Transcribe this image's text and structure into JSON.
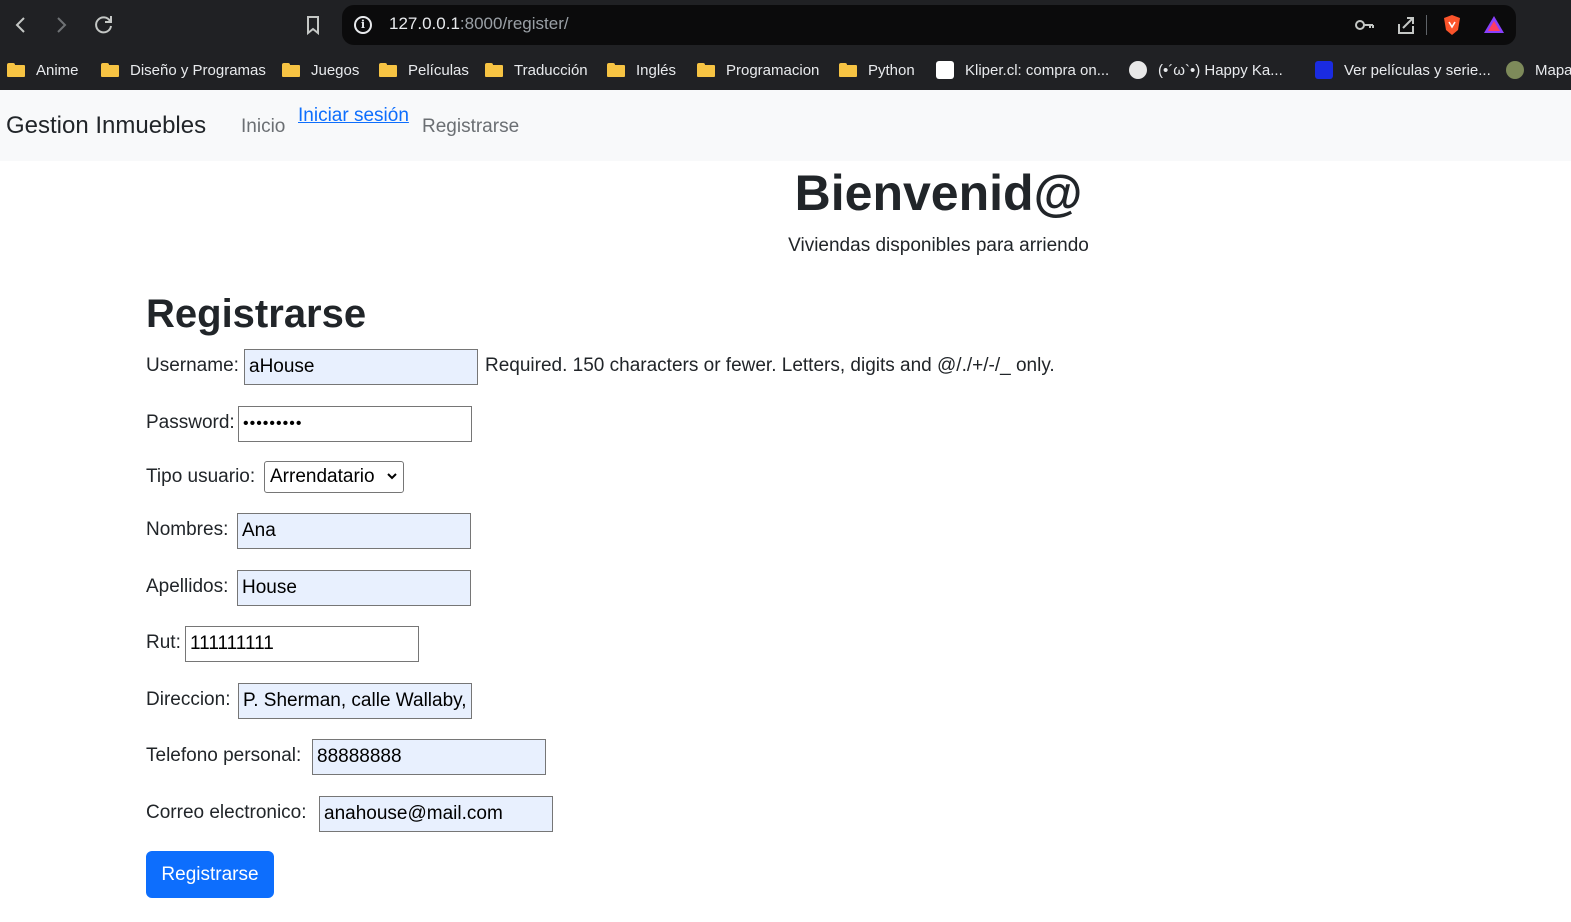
{
  "browser": {
    "url_host": "127.0.0.1",
    "url_rest": ":8000/register/",
    "bookmarks": [
      {
        "label": "Anime",
        "icon": "folder-icon"
      },
      {
        "label": "Diseño y Programas",
        "icon": "folder-icon"
      },
      {
        "label": "Juegos",
        "icon": "folder-icon"
      },
      {
        "label": "Películas",
        "icon": "folder-icon"
      },
      {
        "label": "Traducción",
        "icon": "folder-icon"
      },
      {
        "label": "Inglés",
        "icon": "folder-icon"
      },
      {
        "label": "Programacion",
        "icon": "folder-icon"
      },
      {
        "label": "Python",
        "icon": "folder-icon"
      },
      {
        "label": "Kliper.cl: compra on...",
        "icon": "kliper-favicon"
      },
      {
        "label": "(•´ω`•) Happy Ka...",
        "icon": "panda-favicon"
      },
      {
        "label": "Ver películas y serie...",
        "icon": "m-favicon"
      },
      {
        "label": "Mapa",
        "icon": "globe-favicon"
      }
    ]
  },
  "navbar": {
    "brand": "Gestion Inmuebles",
    "links": [
      "Inicio",
      "Iniciar sesión",
      "Registrarse"
    ]
  },
  "hero": {
    "title": "Bienvenid@",
    "subtitle": "Viviendas disponibles para arriendo"
  },
  "form": {
    "title": "Registrarse",
    "username": {
      "label": "Username:",
      "value": "aHouse",
      "help": "Required. 150 characters or fewer. Letters, digits and @/./+/-/_ only."
    },
    "password": {
      "label": "Password:",
      "value": "•••••••••"
    },
    "tipo_usuario": {
      "label": "Tipo usuario:",
      "selected": "Arrendatario"
    },
    "nombres": {
      "label": "Nombres:",
      "value": "Ana"
    },
    "apellidos": {
      "label": "Apellidos:",
      "value": "House"
    },
    "rut": {
      "label": "Rut:",
      "value": "111111111"
    },
    "direccion": {
      "label": "Direccion:",
      "value": "P. Sherman, calle Wallaby,"
    },
    "telefono": {
      "label": "Telefono personal:",
      "value": "88888888"
    },
    "correo": {
      "label": "Correo electronico:",
      "value": "anahouse@mail.com"
    },
    "submit_label": "Registrarse"
  },
  "colors": {
    "primary": "#0d6efd",
    "autofill": "#e8f0fe",
    "navbar_bg": "#f8f9fa",
    "chrome_bg": "#202124"
  }
}
